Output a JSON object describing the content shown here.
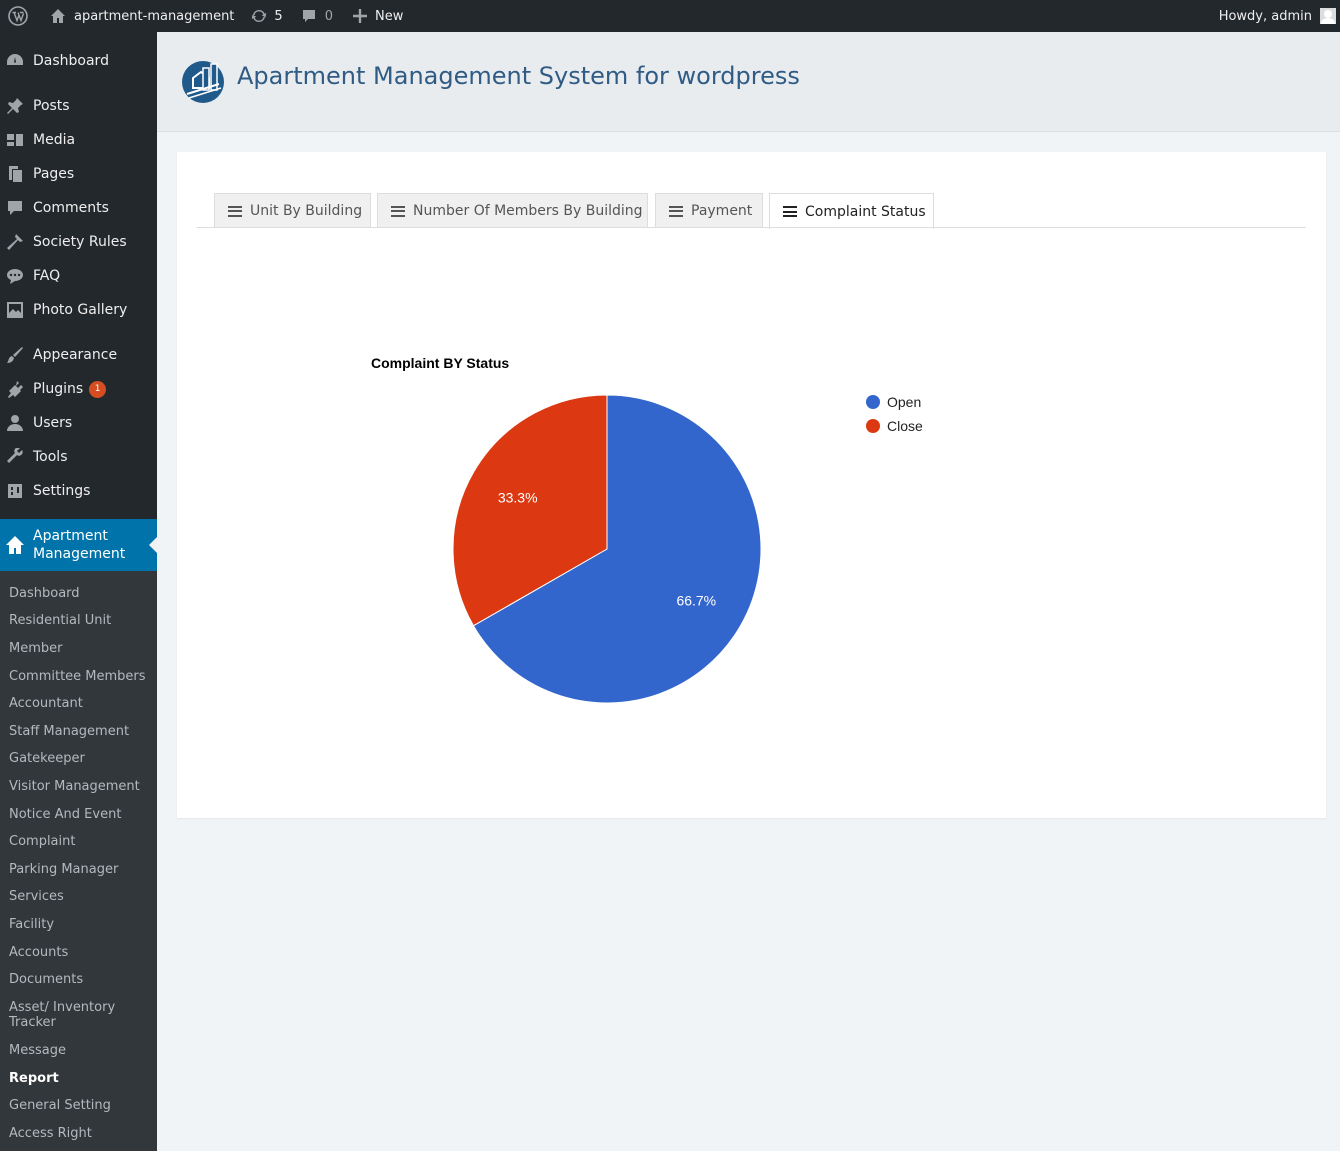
{
  "adminbar": {
    "site_name": "apartment-management",
    "updates_count": "5",
    "comments_count": "0",
    "new_label": "New",
    "howdy": "Howdy, admin"
  },
  "sidebar": {
    "items": [
      {
        "label": "Dashboard",
        "icon": "dashboard-icon"
      },
      {
        "label": "Posts",
        "icon": "pin-icon"
      },
      {
        "label": "Media",
        "icon": "media-icon"
      },
      {
        "label": "Pages",
        "icon": "pages-icon"
      },
      {
        "label": "Comments",
        "icon": "comment-icon"
      },
      {
        "label": "Society Rules",
        "icon": "hammer-icon"
      },
      {
        "label": "FAQ",
        "icon": "chat-icon"
      },
      {
        "label": "Photo Gallery",
        "icon": "gallery-icon"
      },
      {
        "label": "Appearance",
        "icon": "brush-icon"
      },
      {
        "label": "Plugins",
        "icon": "plugin-icon",
        "badge": "1"
      },
      {
        "label": "Users",
        "icon": "user-icon"
      },
      {
        "label": "Tools",
        "icon": "wrench-icon"
      },
      {
        "label": "Settings",
        "icon": "settings-icon"
      }
    ],
    "current": {
      "label": "Apartment Management",
      "icon": "home-icon"
    },
    "submenu": [
      "Dashboard",
      "Residential Unit",
      "Member",
      "Committee Members",
      "Accountant",
      "Staff Management",
      "Gatekeeper",
      "Visitor Management",
      "Notice And Event",
      "Complaint",
      "Parking Manager",
      "Services",
      "Facility",
      "Accounts",
      "Documents",
      "Asset/ Inventory Tracker",
      "Message",
      "Report",
      "General Setting",
      "Access Right"
    ],
    "submenu_active": "Report"
  },
  "header": {
    "title": "Apartment Management System for wordpress"
  },
  "tabs": [
    {
      "label": "Unit By Building",
      "active": false
    },
    {
      "label": "Number Of Members By Building",
      "active": false
    },
    {
      "label": "Payment",
      "active": false
    },
    {
      "label": "Complaint Status",
      "active": true
    }
  ],
  "chart_data": {
    "type": "pie",
    "title": "Complaint BY Status",
    "categories": [
      "Open",
      "Close"
    ],
    "values": [
      66.7,
      33.3
    ],
    "labels": [
      "66.7%",
      "33.3%"
    ],
    "colors": [
      "#3366cc",
      "#dc3912"
    ],
    "legend": "right"
  }
}
